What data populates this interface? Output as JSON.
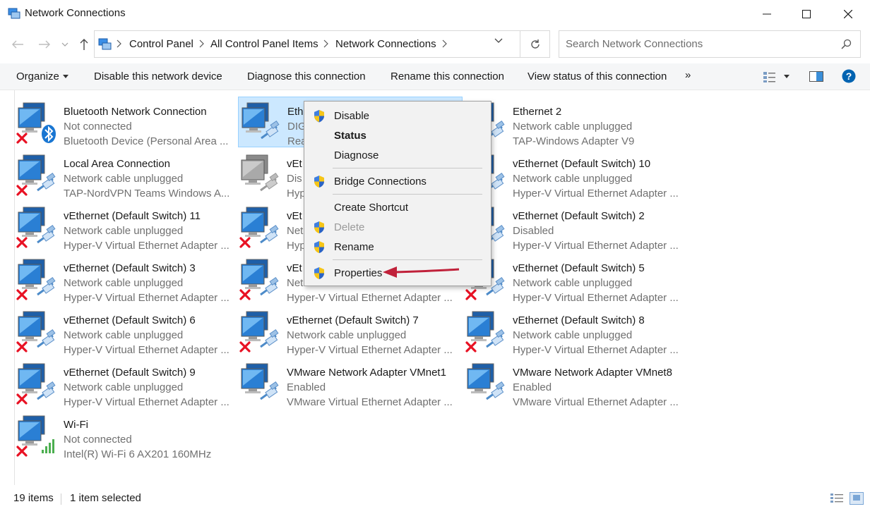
{
  "window": {
    "title": "Network Connections"
  },
  "address": {
    "crumbs": [
      "Control Panel",
      "All Control Panel Items",
      "Network Connections"
    ],
    "search_placeholder": "Search Network Connections"
  },
  "toolbar": {
    "organize": "Organize",
    "disable": "Disable this network device",
    "diagnose": "Diagnose this connection",
    "rename": "Rename this connection",
    "view_status": "View status of this connection",
    "more": "»"
  },
  "items": [
    {
      "name": "Bluetooth Network Connection",
      "status": "Not connected",
      "device": "Bluetooth Device (Personal Area ...",
      "icon": "bluetooth-network-icon",
      "state": "x"
    },
    {
      "name": "Eth",
      "status": "DIG",
      "device": "Rea",
      "icon": "ethernet-network-icon",
      "state": "ok"
    },
    {
      "name": "Ethernet 2",
      "status": "Network cable unplugged",
      "device": "TAP-Windows Adapter V9",
      "icon": "ethernet-network-icon",
      "state": "ok"
    },
    {
      "name": "Local Area Connection",
      "status": "Network cable unplugged",
      "device": "TAP-NordVPN Teams Windows A...",
      "icon": "ethernet-network-icon",
      "state": "x"
    },
    {
      "name": "vEt",
      "status": "Dis",
      "device": "Hyp",
      "icon": "ethernet-network-icon",
      "state": "disabled"
    },
    {
      "name": "vEthernet (Default Switch) 10",
      "status": "Network cable unplugged",
      "device": "Hyper-V Virtual Ethernet Adapter ...",
      "icon": "ethernet-network-icon",
      "state": "ok"
    },
    {
      "name": "vEthernet (Default Switch) 11",
      "status": "Network cable unplugged",
      "device": "Hyper-V Virtual Ethernet Adapter ...",
      "icon": "ethernet-network-icon",
      "state": "x"
    },
    {
      "name": "vEt",
      "status": "Net",
      "device": "Hyp",
      "icon": "ethernet-network-icon",
      "state": "x"
    },
    {
      "name": "vEthernet (Default Switch) 2",
      "status": "Disabled",
      "device": "Hyper-V Virtual Ethernet Adapter ...",
      "icon": "ethernet-network-icon",
      "state": "ok"
    },
    {
      "name": "vEthernet (Default Switch) 3",
      "status": "Network cable unplugged",
      "device": "Hyper-V Virtual Ethernet Adapter ...",
      "icon": "ethernet-network-icon",
      "state": "x"
    },
    {
      "name": "vEt",
      "status": "Net",
      "device": "Hyper-V Virtual Ethernet Adapter ...",
      "icon": "ethernet-network-icon",
      "state": "x"
    },
    {
      "name": "vEthernet (Default Switch) 5",
      "status": "Network cable unplugged",
      "device": "Hyper-V Virtual Ethernet Adapter ...",
      "icon": "ethernet-network-icon",
      "state": "x"
    },
    {
      "name": "vEthernet (Default Switch) 6",
      "status": "Network cable unplugged",
      "device": "Hyper-V Virtual Ethernet Adapter ...",
      "icon": "ethernet-network-icon",
      "state": "x"
    },
    {
      "name": "vEthernet (Default Switch) 7",
      "status": "Network cable unplugged",
      "device": "Hyper-V Virtual Ethernet Adapter ...",
      "icon": "ethernet-network-icon",
      "state": "x"
    },
    {
      "name": "vEthernet (Default Switch) 8",
      "status": "Network cable unplugged",
      "device": "Hyper-V Virtual Ethernet Adapter ...",
      "icon": "ethernet-network-icon",
      "state": "x"
    },
    {
      "name": "vEthernet (Default Switch) 9",
      "status": "Network cable unplugged",
      "device": "Hyper-V Virtual Ethernet Adapter ...",
      "icon": "ethernet-network-icon",
      "state": "x"
    },
    {
      "name": "VMware Network Adapter VMnet1",
      "status": "Enabled",
      "device": "VMware Virtual Ethernet Adapter ...",
      "icon": "ethernet-network-icon",
      "state": "ok"
    },
    {
      "name": "VMware Network Adapter VMnet8",
      "status": "Enabled",
      "device": "VMware Virtual Ethernet Adapter ...",
      "icon": "ethernet-network-icon",
      "state": "ok"
    },
    {
      "name": "Wi-Fi",
      "status": "Not connected",
      "device": "Intel(R) Wi-Fi 6 AX201 160MHz",
      "icon": "wifi-network-icon",
      "state": "x"
    }
  ],
  "context_menu": {
    "disable": "Disable",
    "status": "Status",
    "diagnose": "Diagnose",
    "bridge": "Bridge Connections",
    "create_shortcut": "Create Shortcut",
    "delete": "Delete",
    "rename": "Rename",
    "properties": "Properties"
  },
  "status_bar": {
    "count": "19 items",
    "selected": "1 item selected"
  },
  "colors": {
    "accent": "#0078d7",
    "selection": "#cce8ff",
    "annotation_arrow": "#c0213a",
    "error_x": "#e81123",
    "help": "#0063b1"
  }
}
